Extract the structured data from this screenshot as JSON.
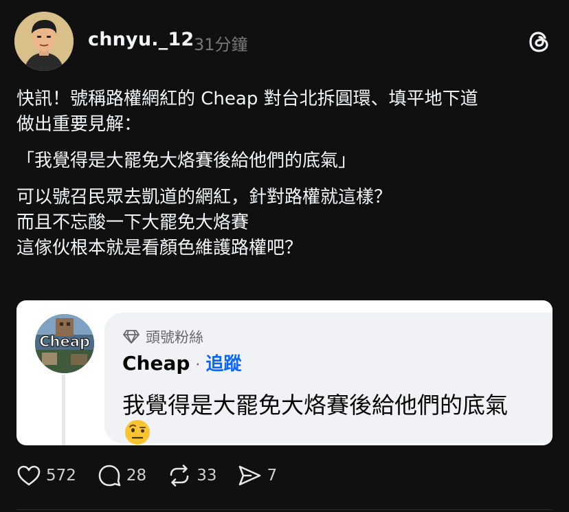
{
  "post": {
    "username": "chnyu._12",
    "time": "31分鐘",
    "body": {
      "line1": "快訊！號稱路權網紅的 Cheap 對台北拆圓環、填平地下道",
      "line2": "做出重要見解：",
      "quote": "「我覺得是大罷免大烙賽後給他們的底氣」",
      "line3": "可以號召民眾去凱道的網紅，針對路權就這樣？",
      "line4": "而且不忘酸一下大罷免大烙賽",
      "line5": "這傢伙根本就是看顏色維護路權吧？"
    },
    "icons": {
      "avatar": "user-avatar-illustration",
      "menu": "threads-logo-icon"
    }
  },
  "embedded_comment": {
    "avatar_label": "Cheap",
    "badge_icon": "diamond-icon",
    "badge": "頭號粉絲",
    "name": "Cheap",
    "separator": "·",
    "follow": "追蹤",
    "text": "我覺得是大罷免大烙賽後給他們的底氣",
    "emoji": "raised-eyebrow-emoji"
  },
  "actions": {
    "likes": "572",
    "replies": "28",
    "reposts": "33",
    "shares": "7"
  },
  "colors": {
    "background": "#101010",
    "text": "#f3f5f7",
    "muted": "#777777",
    "follow_link": "#0866ff",
    "bubble": "#f0f2f5"
  }
}
